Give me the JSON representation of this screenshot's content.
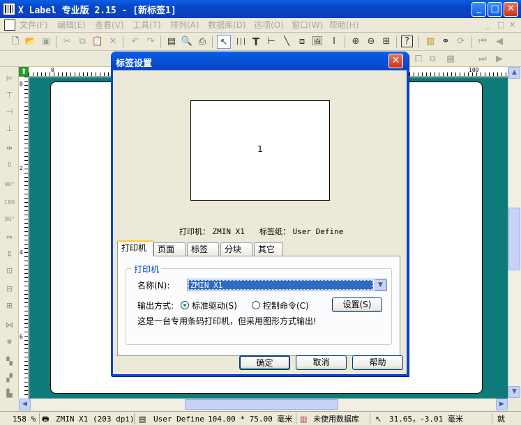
{
  "window": {
    "title": "X Label 专业版 2.15 - [新标签1]",
    "minimize_glyph": "_",
    "maximize_glyph": "□",
    "close_glyph": "✕"
  },
  "menu": {
    "items": [
      "文件(F)",
      "编辑(E)",
      "查看(V)",
      "工具(T)",
      "排列(A)",
      "数据库(D)",
      "选项(O)",
      "窗口(W)",
      "帮助(H)"
    ],
    "mdi_controls": [
      "_",
      "□",
      "✕"
    ]
  },
  "toolbar": {
    "icons": [
      "new-file-icon",
      "open-folder-icon",
      "save-icon",
      "cut-icon",
      "copy-icon",
      "paste-icon",
      "delete-icon",
      "undo-icon",
      "redo-icon",
      "page-setup-icon",
      "print-preview-icon",
      "print-icon",
      "select-arrow-icon",
      "barcode-icon",
      "text-icon",
      "hline-icon",
      "line-icon",
      "shape-icon",
      "image-icon",
      "cursor-text-icon",
      "zoom-in-icon",
      "zoom-out-icon",
      "fit-page-icon",
      "help-icon",
      "database-icon",
      "binoculars-icon",
      "refresh-icon",
      "first-page-icon",
      "prev-page-icon"
    ]
  },
  "rulers": {
    "h_labels": [
      "0",
      "100"
    ],
    "v_labels": [
      "0",
      "2",
      "4",
      "6"
    ]
  },
  "canvas": {
    "background_color": "#0e7a7a"
  },
  "dialog": {
    "title": "标签设置",
    "close_glyph": "✕",
    "preview_label_number": "1",
    "printer_info_label": "打印机：",
    "printer_info_value": "ZMIN X1",
    "label_paper_label": "标签纸：",
    "label_paper_value": "User Define",
    "tabs": [
      {
        "label": "打印机",
        "active": true
      },
      {
        "label": "页面",
        "active": false
      },
      {
        "label": "标签",
        "active": false
      },
      {
        "label": "分块",
        "active": false
      },
      {
        "label": "其它",
        "active": false
      }
    ],
    "group_title": "打印机",
    "name_label": "名称(N):",
    "printer_name": "ZMIN X1",
    "output_mode_label": "输出方式:",
    "radio_driver": {
      "label": "标准驱动(S)",
      "checked": true
    },
    "radio_command": {
      "label": "控制命令(C)",
      "checked": false
    },
    "settings_button": "设置(S)",
    "description": "这是一台专用条码打印机，但采用图形方式输出!",
    "ok_button": "确定",
    "cancel_button": "取消",
    "help_button": "帮助"
  },
  "statusbar": {
    "zoom": "158 %",
    "printer": "ZMIN X1 (203 dpi)",
    "paper": "User Define",
    "size": "104.00 * 75.00 毫米",
    "database": "未使用数据库",
    "cursor": "31.65，-3.01 毫米",
    "mode": "就"
  }
}
